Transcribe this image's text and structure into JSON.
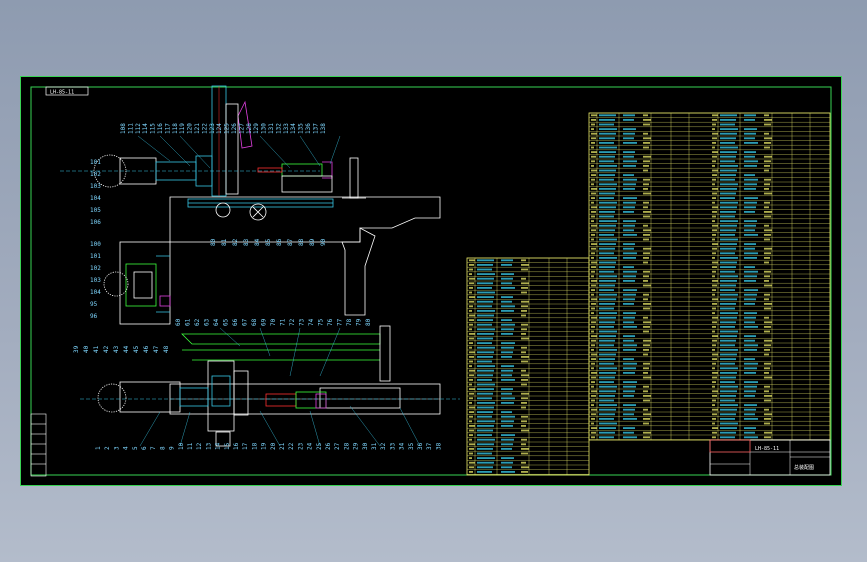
{
  "drawing": {
    "frame_tag": "LH-85-11",
    "title_block_name": "LH-85-11",
    "title_block_subtitle": "总装配图",
    "colors": {
      "background": "#000000",
      "frame": "#39d353",
      "part_cyan": "#39c8e8",
      "part_white": "#ffffff",
      "table_yellow": "#e9e96a",
      "table_cyan": "#39d0f0",
      "accent_magenta": "#e040e0",
      "accent_green": "#3cff3c",
      "accent_red": "#ff3030"
    }
  },
  "callouts": {
    "top_view": [
      "108",
      "111",
      "112",
      "114",
      "115",
      "116",
      "117",
      "118",
      "119",
      "120",
      "121",
      "122",
      "123",
      "124",
      "125",
      "126",
      "127",
      "128",
      "129",
      "130",
      "131",
      "132",
      "133",
      "134",
      "135",
      "136",
      "137",
      "138"
    ],
    "left_top": [
      "101",
      "102",
      "103",
      "104",
      "105",
      "106"
    ],
    "left_mid": [
      "100",
      "101",
      "102",
      "103",
      "104",
      "95",
      "96"
    ],
    "under_bed": [
      "80",
      "81",
      "82",
      "83",
      "84",
      "85",
      "86",
      "87",
      "88",
      "89",
      "90"
    ],
    "front_top": [
      "60",
      "61",
      "62",
      "63",
      "64",
      "65",
      "66",
      "67",
      "68",
      "69",
      "70",
      "71",
      "72",
      "73",
      "74",
      "75",
      "76",
      "77",
      "78",
      "79",
      "80"
    ],
    "front_left": [
      "39",
      "40",
      "41",
      "42",
      "43",
      "44",
      "45",
      "46",
      "47",
      "48"
    ],
    "bottom": [
      "1",
      "2",
      "3",
      "4",
      "5",
      "6",
      "7",
      "8",
      "9",
      "10",
      "11",
      "12",
      "13",
      "14",
      "15",
      "16",
      "17",
      "18",
      "19",
      "20",
      "21",
      "22",
      "23",
      "24",
      "25",
      "26",
      "27",
      "28",
      "29",
      "30",
      "31",
      "32",
      "33",
      "34",
      "35",
      "36",
      "37",
      "38"
    ]
  }
}
